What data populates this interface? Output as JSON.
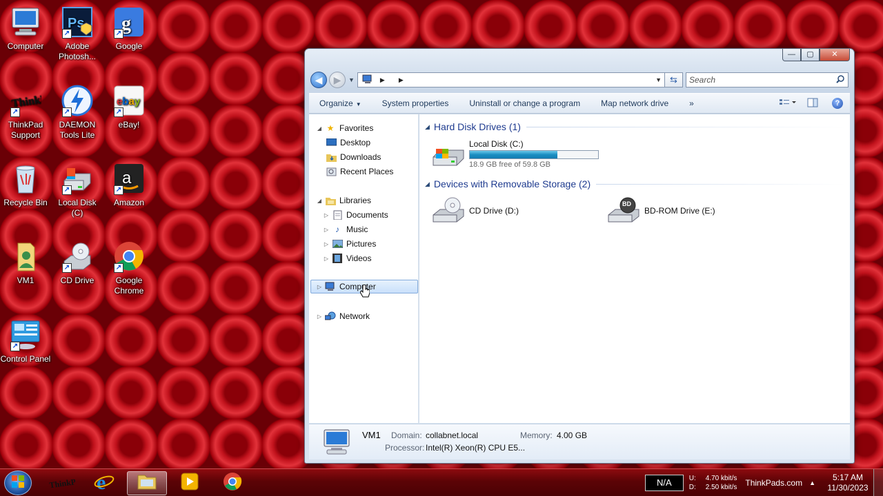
{
  "desktop": {
    "icons": [
      {
        "label": "Computer"
      },
      {
        "label": "Adobe Photosh..."
      },
      {
        "label": "Google"
      },
      {
        "label": "ThinkPad Support"
      },
      {
        "label": "DAEMON Tools Lite"
      },
      {
        "label": "eBay!"
      },
      {
        "label": "Recycle Bin"
      },
      {
        "label": "Local Disk (C)"
      },
      {
        "label": "Amazon"
      },
      {
        "label": "VM1"
      },
      {
        "label": "CD Drive"
      },
      {
        "label": "Google Chrome"
      },
      {
        "label": "Control Panel"
      }
    ]
  },
  "window": {
    "controls": {
      "minimize": "—",
      "maximize": "▢",
      "close": "✕"
    },
    "search_placeholder": "Search",
    "toolbar": {
      "organize": "Organize",
      "system_properties": "System properties",
      "uninstall": "Uninstall or change a program",
      "map_drive": "Map network drive",
      "more": "»"
    },
    "nav": {
      "favorites": "Favorites",
      "desktop": "Desktop",
      "downloads": "Downloads",
      "recent": "Recent Places",
      "libraries": "Libraries",
      "documents": "Documents",
      "music": "Music",
      "pictures": "Pictures",
      "videos": "Videos",
      "computer": "Computer",
      "network": "Network"
    },
    "groups": {
      "hdd_title": "Hard Disk Drives (1)",
      "removable_title": "Devices with Removable Storage (2)"
    },
    "drives": {
      "c_name": "Local Disk (C:)",
      "c_free": "18.9 GB free of 59.8 GB",
      "c_used_fraction": 0.684,
      "d_name": "CD Drive (D:)",
      "e_name": "BD-ROM Drive (E:)",
      "e_badge": "BD"
    },
    "details": {
      "name": "VM1",
      "domain_label": "Domain:",
      "domain": "collabnet.local",
      "memory_label": "Memory:",
      "memory": "4.00 GB",
      "processor_label": "Processor:",
      "processor": "Intel(R) Xeon(R) CPU E5..."
    }
  },
  "taskbar": {
    "na": "N/A",
    "u_label": "U:",
    "d_label": "D:",
    "up_rate": "4.70 kbit/s",
    "down_rate": "2.50 kbit/s",
    "tray_text": "ThinkPads.com",
    "time": "5:17 AM",
    "date": "11/30/2023"
  }
}
